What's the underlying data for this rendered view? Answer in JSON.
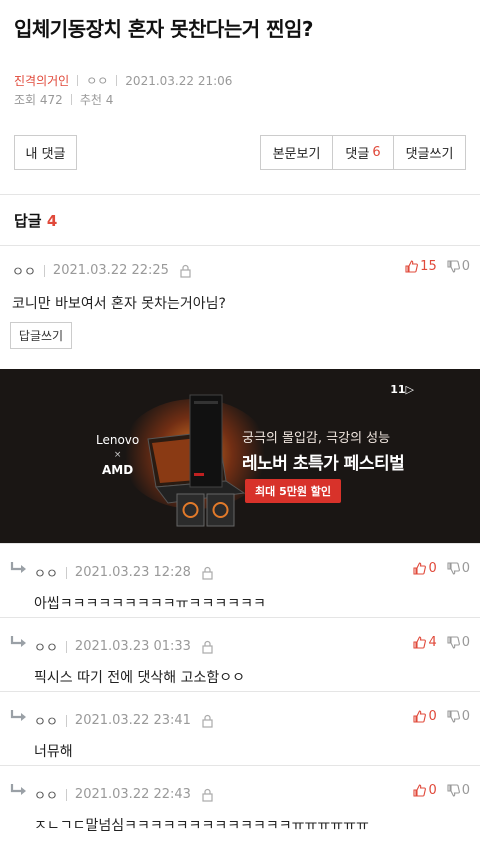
{
  "post": {
    "title": "입체기동장치 혼자 못찬다는거 찐임?",
    "author": "진격의거인",
    "nickname": "ㅇㅇ",
    "datetime": "2021.03.22 21:06",
    "views": "조회 472",
    "likes": "추천 4"
  },
  "toolbar": {
    "my_comments": "내 댓글",
    "view_post": "본문보기",
    "comments_label": "댓글",
    "comments_count": "6",
    "write_comment": "댓글쓰기"
  },
  "replies": {
    "label": "답글",
    "count": "4"
  },
  "main_comment": {
    "nick": "ㅇㅇ",
    "datetime": "2021.03.22 22:25",
    "up": "15",
    "down": "0",
    "text": "코니만 바보여서 혼자 못차는거아님?",
    "reply_button": "답글쓰기"
  },
  "ad": {
    "brand_top": "Lenovo",
    "brand_x": "×",
    "brand_bottom": "AMD",
    "store_logo": "11",
    "line1": "궁극의 몰입감, 극강의 성능",
    "line2": "레노버 초특가 페스티벌",
    "badge": "최대 5만원 할인"
  },
  "comments": [
    {
      "nick": "ㅇㅇ",
      "datetime": "2021.03.23 12:28",
      "up": "0",
      "down": "0",
      "text": "아씹ㅋㅋㅋㅋㅋㅋㅋㅋㅋㅠㅋㅋㅋㅋㅋㅋ"
    },
    {
      "nick": "ㅇㅇ",
      "datetime": "2021.03.23 01:33",
      "up": "4",
      "down": "0",
      "text": "픽시스 따기 전에 댓삭해 고소함ㅇㅇ"
    },
    {
      "nick": "ㅇㅇ",
      "datetime": "2021.03.22 23:41",
      "up": "0",
      "down": "0",
      "text": "너뮤해"
    },
    {
      "nick": "ㅇㅇ",
      "datetime": "2021.03.22 22:43",
      "up": "0",
      "down": "0",
      "text": "ㅈㄴㄱㄷ말넘심ㅋㅋㅋㅋㅋㅋㅋㅋㅋㅋㅋㅋㅋㅠㅠㅠㅠㅠㅠ"
    }
  ],
  "colors": {
    "accent": "#e0493a",
    "muted": "#999999"
  }
}
